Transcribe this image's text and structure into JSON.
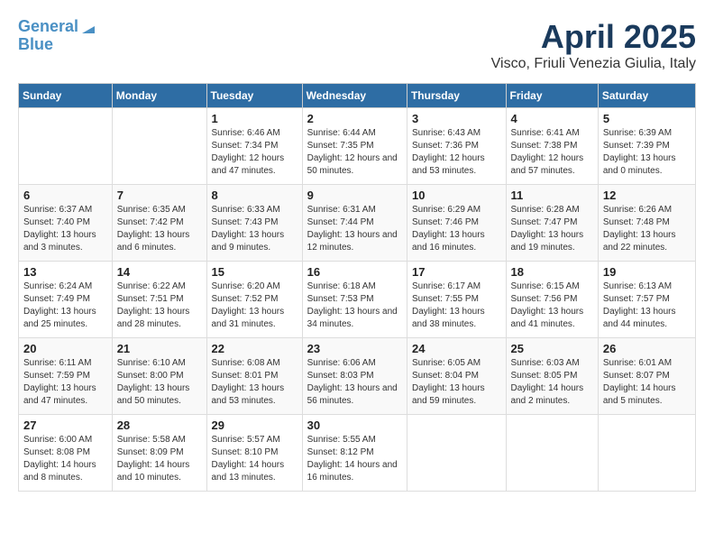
{
  "header": {
    "logo_line1": "General",
    "logo_line2": "Blue",
    "title": "April 2025",
    "subtitle": "Visco, Friuli Venezia Giulia, Italy"
  },
  "days_of_week": [
    "Sunday",
    "Monday",
    "Tuesday",
    "Wednesday",
    "Thursday",
    "Friday",
    "Saturday"
  ],
  "weeks": [
    [
      {
        "num": "",
        "sunrise": "",
        "sunset": "",
        "daylight": ""
      },
      {
        "num": "",
        "sunrise": "",
        "sunset": "",
        "daylight": ""
      },
      {
        "num": "1",
        "sunrise": "Sunrise: 6:46 AM",
        "sunset": "Sunset: 7:34 PM",
        "daylight": "Daylight: 12 hours and 47 minutes."
      },
      {
        "num": "2",
        "sunrise": "Sunrise: 6:44 AM",
        "sunset": "Sunset: 7:35 PM",
        "daylight": "Daylight: 12 hours and 50 minutes."
      },
      {
        "num": "3",
        "sunrise": "Sunrise: 6:43 AM",
        "sunset": "Sunset: 7:36 PM",
        "daylight": "Daylight: 12 hours and 53 minutes."
      },
      {
        "num": "4",
        "sunrise": "Sunrise: 6:41 AM",
        "sunset": "Sunset: 7:38 PM",
        "daylight": "Daylight: 12 hours and 57 minutes."
      },
      {
        "num": "5",
        "sunrise": "Sunrise: 6:39 AM",
        "sunset": "Sunset: 7:39 PM",
        "daylight": "Daylight: 13 hours and 0 minutes."
      }
    ],
    [
      {
        "num": "6",
        "sunrise": "Sunrise: 6:37 AM",
        "sunset": "Sunset: 7:40 PM",
        "daylight": "Daylight: 13 hours and 3 minutes."
      },
      {
        "num": "7",
        "sunrise": "Sunrise: 6:35 AM",
        "sunset": "Sunset: 7:42 PM",
        "daylight": "Daylight: 13 hours and 6 minutes."
      },
      {
        "num": "8",
        "sunrise": "Sunrise: 6:33 AM",
        "sunset": "Sunset: 7:43 PM",
        "daylight": "Daylight: 13 hours and 9 minutes."
      },
      {
        "num": "9",
        "sunrise": "Sunrise: 6:31 AM",
        "sunset": "Sunset: 7:44 PM",
        "daylight": "Daylight: 13 hours and 12 minutes."
      },
      {
        "num": "10",
        "sunrise": "Sunrise: 6:29 AM",
        "sunset": "Sunset: 7:46 PM",
        "daylight": "Daylight: 13 hours and 16 minutes."
      },
      {
        "num": "11",
        "sunrise": "Sunrise: 6:28 AM",
        "sunset": "Sunset: 7:47 PM",
        "daylight": "Daylight: 13 hours and 19 minutes."
      },
      {
        "num": "12",
        "sunrise": "Sunrise: 6:26 AM",
        "sunset": "Sunset: 7:48 PM",
        "daylight": "Daylight: 13 hours and 22 minutes."
      }
    ],
    [
      {
        "num": "13",
        "sunrise": "Sunrise: 6:24 AM",
        "sunset": "Sunset: 7:49 PM",
        "daylight": "Daylight: 13 hours and 25 minutes."
      },
      {
        "num": "14",
        "sunrise": "Sunrise: 6:22 AM",
        "sunset": "Sunset: 7:51 PM",
        "daylight": "Daylight: 13 hours and 28 minutes."
      },
      {
        "num": "15",
        "sunrise": "Sunrise: 6:20 AM",
        "sunset": "Sunset: 7:52 PM",
        "daylight": "Daylight: 13 hours and 31 minutes."
      },
      {
        "num": "16",
        "sunrise": "Sunrise: 6:18 AM",
        "sunset": "Sunset: 7:53 PM",
        "daylight": "Daylight: 13 hours and 34 minutes."
      },
      {
        "num": "17",
        "sunrise": "Sunrise: 6:17 AM",
        "sunset": "Sunset: 7:55 PM",
        "daylight": "Daylight: 13 hours and 38 minutes."
      },
      {
        "num": "18",
        "sunrise": "Sunrise: 6:15 AM",
        "sunset": "Sunset: 7:56 PM",
        "daylight": "Daylight: 13 hours and 41 minutes."
      },
      {
        "num": "19",
        "sunrise": "Sunrise: 6:13 AM",
        "sunset": "Sunset: 7:57 PM",
        "daylight": "Daylight: 13 hours and 44 minutes."
      }
    ],
    [
      {
        "num": "20",
        "sunrise": "Sunrise: 6:11 AM",
        "sunset": "Sunset: 7:59 PM",
        "daylight": "Daylight: 13 hours and 47 minutes."
      },
      {
        "num": "21",
        "sunrise": "Sunrise: 6:10 AM",
        "sunset": "Sunset: 8:00 PM",
        "daylight": "Daylight: 13 hours and 50 minutes."
      },
      {
        "num": "22",
        "sunrise": "Sunrise: 6:08 AM",
        "sunset": "Sunset: 8:01 PM",
        "daylight": "Daylight: 13 hours and 53 minutes."
      },
      {
        "num": "23",
        "sunrise": "Sunrise: 6:06 AM",
        "sunset": "Sunset: 8:03 PM",
        "daylight": "Daylight: 13 hours and 56 minutes."
      },
      {
        "num": "24",
        "sunrise": "Sunrise: 6:05 AM",
        "sunset": "Sunset: 8:04 PM",
        "daylight": "Daylight: 13 hours and 59 minutes."
      },
      {
        "num": "25",
        "sunrise": "Sunrise: 6:03 AM",
        "sunset": "Sunset: 8:05 PM",
        "daylight": "Daylight: 14 hours and 2 minutes."
      },
      {
        "num": "26",
        "sunrise": "Sunrise: 6:01 AM",
        "sunset": "Sunset: 8:07 PM",
        "daylight": "Daylight: 14 hours and 5 minutes."
      }
    ],
    [
      {
        "num": "27",
        "sunrise": "Sunrise: 6:00 AM",
        "sunset": "Sunset: 8:08 PM",
        "daylight": "Daylight: 14 hours and 8 minutes."
      },
      {
        "num": "28",
        "sunrise": "Sunrise: 5:58 AM",
        "sunset": "Sunset: 8:09 PM",
        "daylight": "Daylight: 14 hours and 10 minutes."
      },
      {
        "num": "29",
        "sunrise": "Sunrise: 5:57 AM",
        "sunset": "Sunset: 8:10 PM",
        "daylight": "Daylight: 14 hours and 13 minutes."
      },
      {
        "num": "30",
        "sunrise": "Sunrise: 5:55 AM",
        "sunset": "Sunset: 8:12 PM",
        "daylight": "Daylight: 14 hours and 16 minutes."
      },
      {
        "num": "",
        "sunrise": "",
        "sunset": "",
        "daylight": ""
      },
      {
        "num": "",
        "sunrise": "",
        "sunset": "",
        "daylight": ""
      },
      {
        "num": "",
        "sunrise": "",
        "sunset": "",
        "daylight": ""
      }
    ]
  ]
}
